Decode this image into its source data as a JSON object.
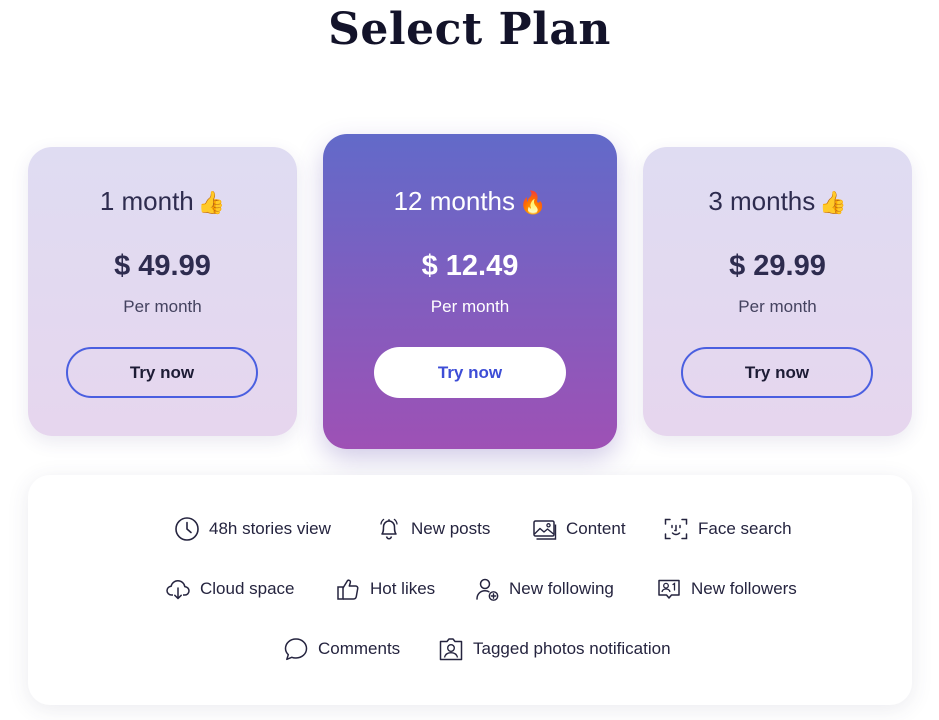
{
  "page": {
    "title": "Select Plan"
  },
  "plans": [
    {
      "name": "1 month",
      "emoji": "👍",
      "price": "$ 49.99",
      "period": "Per month",
      "button_label": "Try now",
      "style": "light"
    },
    {
      "name": "12 months",
      "emoji": "🔥",
      "price": "$ 12.49",
      "period": "Per month",
      "button_label": "Try now",
      "style": "featured"
    },
    {
      "name": "3 months",
      "emoji": "👍",
      "price": "$ 29.99",
      "period": "Per month",
      "button_label": "Try now",
      "style": "light"
    }
  ],
  "features": [
    {
      "label": "48h stories view",
      "icon": "clock-icon"
    },
    {
      "label": "New posts",
      "icon": "bell-icon"
    },
    {
      "label": "Content",
      "icon": "image-stack-icon"
    },
    {
      "label": "Face search",
      "icon": "face-scan-icon"
    },
    {
      "label": "Cloud space",
      "icon": "cloud-download-icon"
    },
    {
      "label": "Hot likes",
      "icon": "thumbs-up-icon"
    },
    {
      "label": "New following",
      "icon": "user-add-icon"
    },
    {
      "label": "New followers",
      "icon": "followers-badge-icon"
    },
    {
      "label": "Comments",
      "icon": "comment-bubble-icon"
    },
    {
      "label": "Tagged photos notification",
      "icon": "tagged-photo-icon"
    }
  ],
  "colors": {
    "featured_gradient_top": "#626ac9",
    "featured_gradient_bottom": "#9e51b5",
    "light_card_top": "#dfdcf2",
    "light_card_bottom": "#e6d6ee",
    "button_outline": "#4a5fe0",
    "featured_button_text": "#3d4dd6"
  }
}
